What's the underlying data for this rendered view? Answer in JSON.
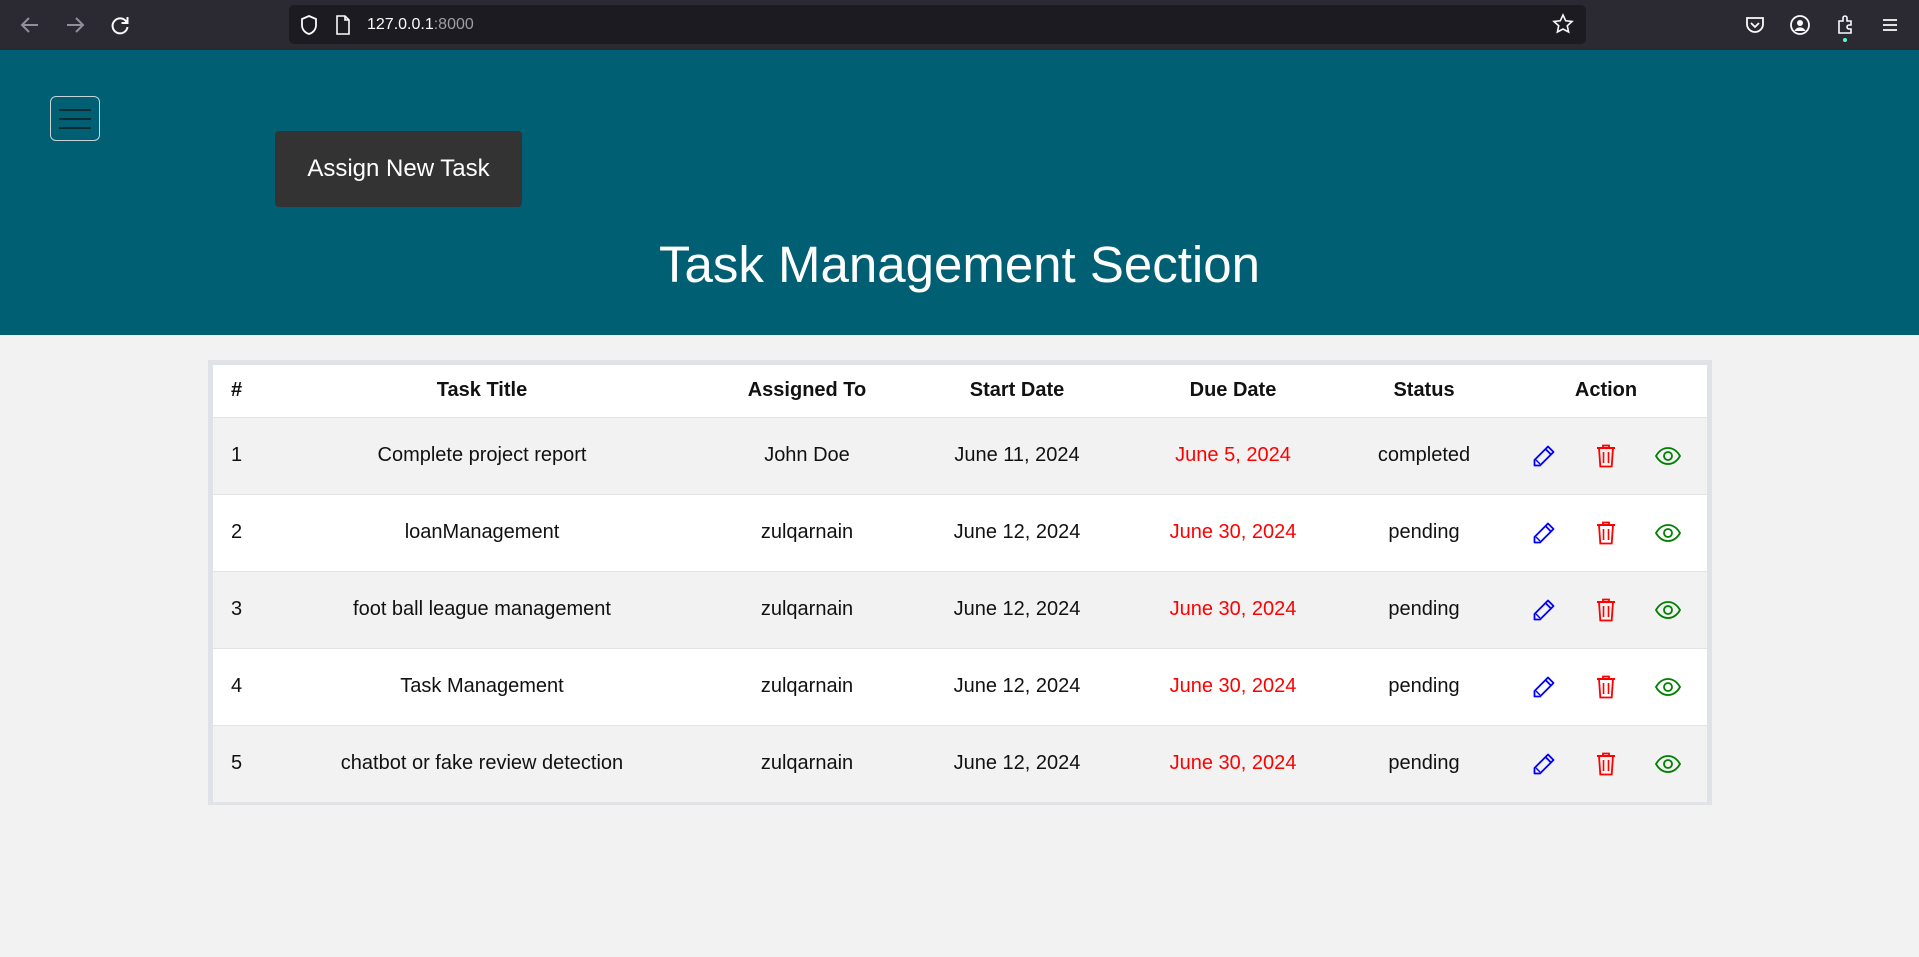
{
  "browser": {
    "url_host": "127.0.0.1",
    "url_port": ":8000"
  },
  "header": {
    "assign_button_label": "Assign New Task",
    "title": "Task Management Section"
  },
  "table": {
    "columns": [
      "#",
      "Task Title",
      "Assigned To",
      "Start Date",
      "Due Date",
      "Status",
      "Action"
    ],
    "rows": [
      {
        "num": "1",
        "title": "Complete project report",
        "assigned_to": "John Doe",
        "start_date": "June 11, 2024",
        "due_date": "June 5, 2024",
        "status": "completed"
      },
      {
        "num": "2",
        "title": "loanManagement",
        "assigned_to": "zulqarnain",
        "start_date": "June 12, 2024",
        "due_date": "June 30, 2024",
        "status": "pending"
      },
      {
        "num": "3",
        "title": "foot ball league management",
        "assigned_to": "zulqarnain",
        "start_date": "June 12, 2024",
        "due_date": "June 30, 2024",
        "status": "pending"
      },
      {
        "num": "4",
        "title": "Task Management",
        "assigned_to": "zulqarnain",
        "start_date": "June 12, 2024",
        "due_date": "June 30, 2024",
        "status": "pending"
      },
      {
        "num": "5",
        "title": "chatbot or fake review detection",
        "assigned_to": "zulqarnain",
        "start_date": "June 12, 2024",
        "due_date": "June 30, 2024",
        "status": "pending"
      }
    ]
  },
  "colors": {
    "header_bg": "#005f73",
    "due_date": "#ff0000",
    "edit_icon": "#0000ff",
    "delete_icon": "#ff0000",
    "view_icon": "#008000"
  },
  "icons": {
    "edit": "pencil-icon",
    "delete": "trash-icon",
    "view": "eye-icon"
  }
}
